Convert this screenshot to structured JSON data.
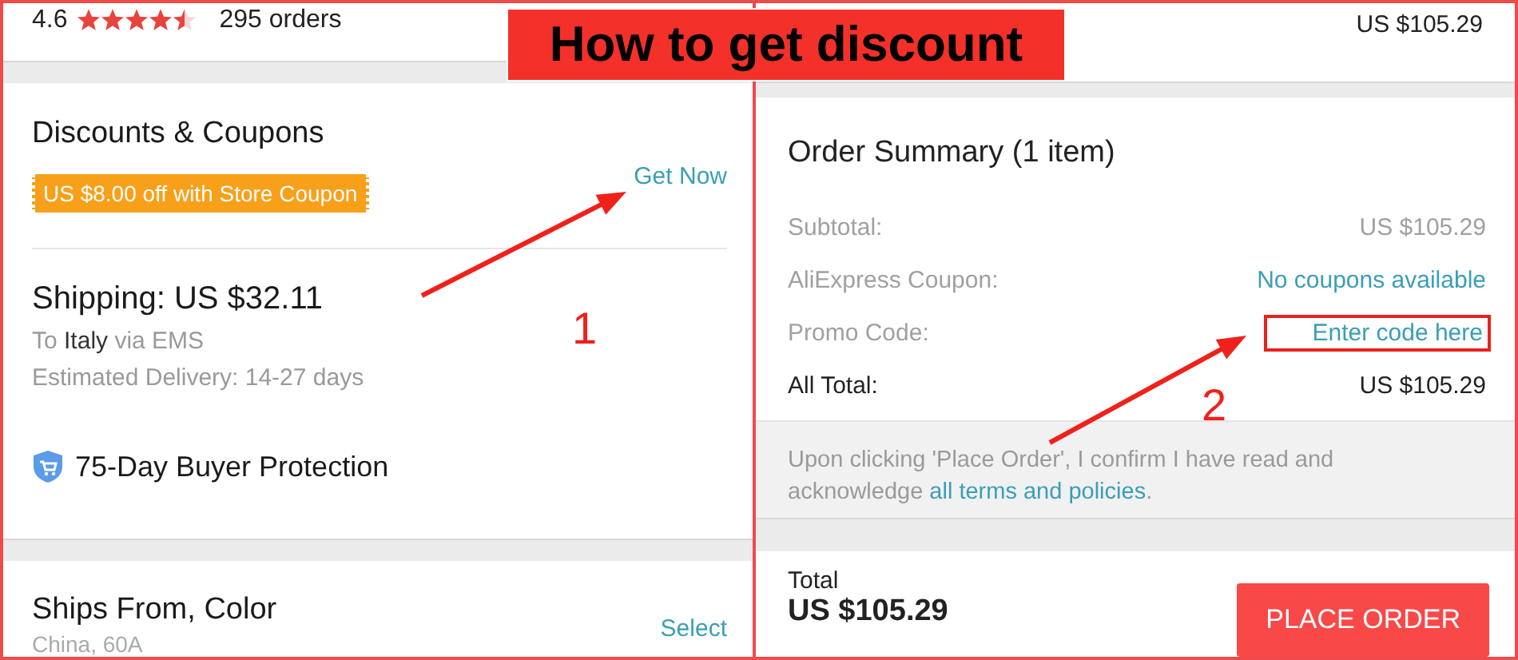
{
  "banner": {
    "title": "How to get discount"
  },
  "product": {
    "rating": "4.6",
    "stars": 4.5,
    "orders": "295 orders"
  },
  "discounts": {
    "title": "Discounts & Coupons",
    "coupon": "US $8.00 off with Store Coupon",
    "action": "Get Now"
  },
  "shipping": {
    "title": "Shipping: US $32.11",
    "destination": "To **Italy** via EMS",
    "delivery": "Estimated Delivery: 14-27 days",
    "protection": "75-Day Buyer Protection"
  },
  "options": {
    "title": "Ships From, Color",
    "action": "Select",
    "value": "China, 60A"
  },
  "top_price": "US $105.29",
  "summary": {
    "title": "Order Summary (1 item)",
    "rows": [
      {
        "label": "Subtotal:",
        "value": "US $105.29",
        "kind": "plain",
        "highlighted": false
      },
      {
        "label": "AliExpress Coupon:",
        "value": "No coupons available",
        "kind": "link",
        "highlighted": false
      },
      {
        "label": "Promo Code:",
        "value": "Enter code here",
        "kind": "input",
        "highlighted": true
      },
      {
        "label": "All Total:",
        "value": "US $105.29",
        "kind": "total",
        "highlighted": false
      }
    ]
  },
  "notice": {
    "text": "Upon clicking 'Place Order', I confirm I have read and acknowledge",
    "link": "all terms and policies",
    "end": "."
  },
  "footer": {
    "label": "Total",
    "amount": "US $105.29",
    "button": "PLACE ORDER"
  },
  "annotations": [
    {
      "number": "1"
    },
    {
      "number": "2"
    }
  ]
}
